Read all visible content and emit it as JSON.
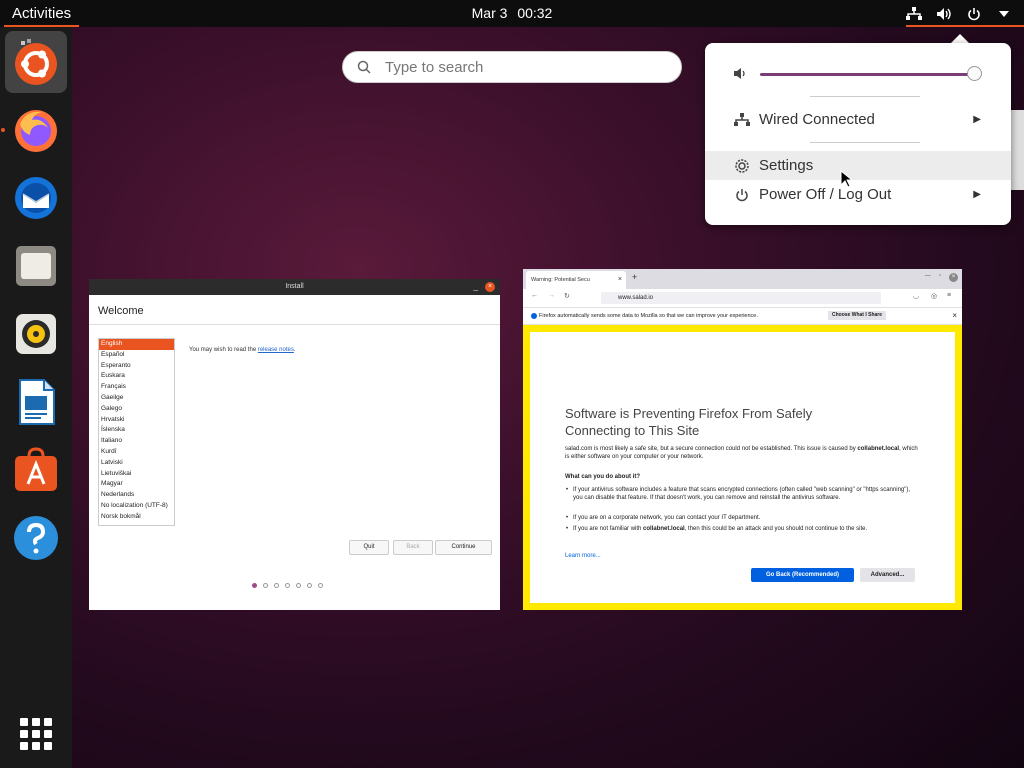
{
  "topbar": {
    "activities": "Activities",
    "date": "Mar 3",
    "time": "00:32"
  },
  "dock": {
    "apps": [
      {
        "name": "Ubuntu Installer",
        "icon": "ubuntu-installer-icon",
        "active": true
      },
      {
        "name": "Firefox",
        "icon": "firefox-icon",
        "running": true
      },
      {
        "name": "Thunderbird",
        "icon": "thunderbird-icon"
      },
      {
        "name": "Files",
        "icon": "files-icon"
      },
      {
        "name": "Rhythmbox",
        "icon": "rhythmbox-icon"
      },
      {
        "name": "LibreOffice Writer",
        "icon": "writer-icon"
      },
      {
        "name": "Ubuntu Software",
        "icon": "software-icon"
      },
      {
        "name": "Help",
        "icon": "help-icon"
      }
    ],
    "show_apps_icon": "apps-grid-icon"
  },
  "search": {
    "placeholder": "Type to search"
  },
  "system_menu": {
    "volume_level": 1.0,
    "wired": "Wired Connected",
    "settings": "Settings",
    "power": "Power Off / Log Out"
  },
  "install_window": {
    "title": "Install",
    "heading": "Welcome",
    "languages": [
      "English",
      "Español",
      "Esperanto",
      "Euskara",
      "Français",
      "Gaeilge",
      "Galego",
      "Hrvatski",
      "Íslenska",
      "Italiano",
      "Kurdî",
      "Latviski",
      "Lietuviškai",
      "Magyar",
      "Nederlands",
      "No localization (UTF-8)",
      "Norsk bokmål"
    ],
    "notes_prefix": "You may wish to read the ",
    "notes_link": "release notes",
    "notes_suffix": ".",
    "quit": "Quit",
    "back": "Back",
    "continue": "Continue"
  },
  "firefox_window": {
    "tab_title": "Warning: Potential Secu",
    "url": "www.salad.io",
    "notice": "Firefox automatically sends some data to Mozilla so that we can improve your experience.",
    "notice_button": "Choose What I Share",
    "heading": "Software is Preventing Firefox From Safely Connecting to This Site",
    "para1_a": "salad.com is most likely a safe site, but a secure connection could not be established. This issue is caused by ",
    "para1_b": "collabnet.local",
    "para1_c": ", which is either software on your computer or your network.",
    "what_heading": "What can you do about it?",
    "bullet1": "If your antivirus software includes a feature that scans encrypted connections (often called \"web scanning\" or \"https scanning\"), you can disable that feature. If that doesn't work, you can remove and reinstall the antivirus software.",
    "bullet2": "If you are on a corporate network, you can contact your IT department.",
    "bullet3_a": "If you are not familiar with ",
    "bullet3_b": "collabnet.local",
    "bullet3_c": ", then this could be an attack and you should not continue to the site.",
    "learn_more": "Learn more...",
    "go_back": "Go Back (Recommended)",
    "advanced": "Advanced..."
  },
  "colors": {
    "accent": "#e95420",
    "purple": "#7a3c74",
    "ff_blue": "#0060df",
    "warning_yellow": "#ffe900"
  }
}
